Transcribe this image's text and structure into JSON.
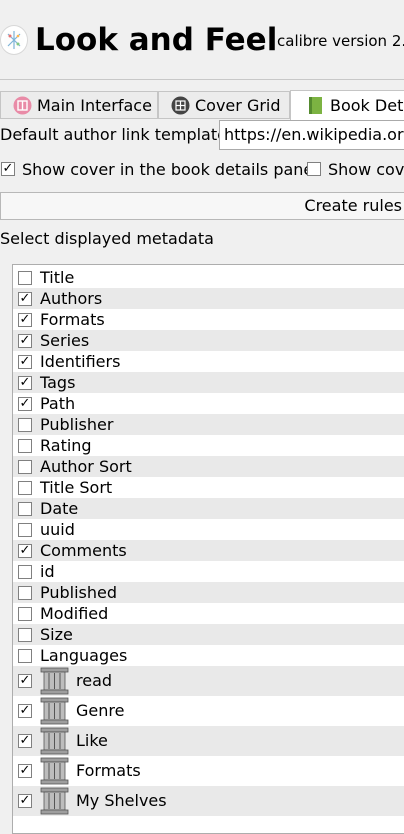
{
  "header": {
    "title": "Look and Feel",
    "version": "calibre version 2."
  },
  "tabs": [
    {
      "label": "Main Interface",
      "icon": "main-interface-icon"
    },
    {
      "label": "Cover Grid",
      "icon": "cover-grid-icon"
    },
    {
      "label": "Book Deta",
      "icon": "book-details-icon",
      "active": true
    }
  ],
  "author_link": {
    "label": "Default author link template:",
    "value": "https://en.wikipedia.org/"
  },
  "checkboxes": {
    "show_cover": {
      "label": "Show cover in the book details panel",
      "checked": true
    },
    "show_cover2": {
      "label": "Show cove",
      "checked": false
    }
  },
  "create_rules_label": "Create rules",
  "metadata": {
    "title": "Select displayed metadata",
    "items": [
      {
        "label": "Title",
        "checked": false
      },
      {
        "label": "Authors",
        "checked": true
      },
      {
        "label": "Formats",
        "checked": true
      },
      {
        "label": "Series",
        "checked": true
      },
      {
        "label": "Identifiers",
        "checked": true
      },
      {
        "label": "Tags",
        "checked": true
      },
      {
        "label": "Path",
        "checked": true
      },
      {
        "label": "Publisher",
        "checked": false
      },
      {
        "label": "Rating",
        "checked": false
      },
      {
        "label": "Author Sort",
        "checked": false
      },
      {
        "label": "Title Sort",
        "checked": false
      },
      {
        "label": "Date",
        "checked": false
      },
      {
        "label": "uuid",
        "checked": false
      },
      {
        "label": "Comments",
        "checked": true
      },
      {
        "label": "id",
        "checked": false
      },
      {
        "label": "Published",
        "checked": false
      },
      {
        "label": "Modified",
        "checked": false
      },
      {
        "label": "Size",
        "checked": false
      },
      {
        "label": "Languages",
        "checked": false
      },
      {
        "label": "read",
        "checked": true,
        "icon": "column-icon"
      },
      {
        "label": "Genre",
        "checked": true,
        "icon": "column-icon"
      },
      {
        "label": "Like",
        "checked": true,
        "icon": "column-icon"
      },
      {
        "label": "Formats",
        "checked": true,
        "icon": "column-icon"
      },
      {
        "label": "My Shelves",
        "checked": true,
        "icon": "column-icon"
      }
    ]
  },
  "colors": {
    "background": "#f0f0f0",
    "alt_row": "#e9e9e9",
    "border": "#adadad"
  }
}
